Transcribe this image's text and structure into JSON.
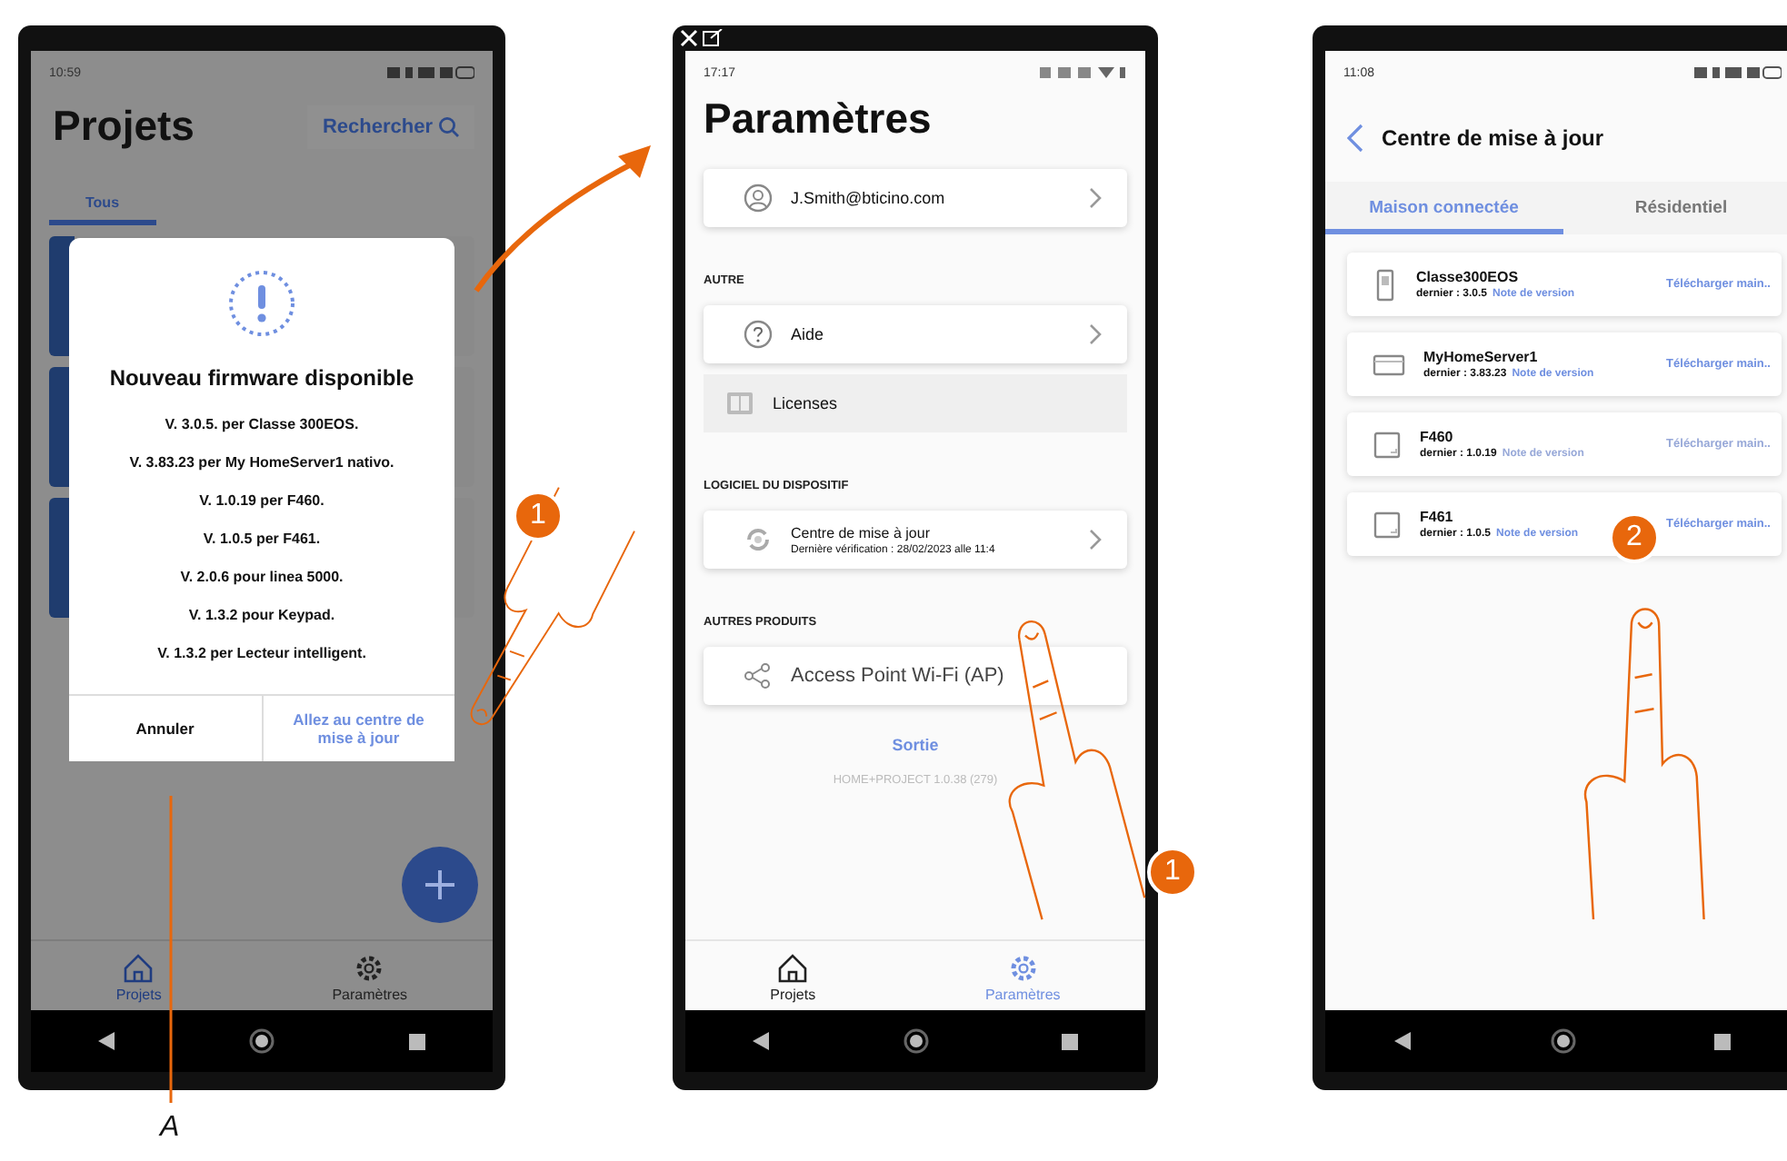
{
  "screen_projects": {
    "status_time": "10:59",
    "title": "Projets",
    "search_label": "Rechercher",
    "tabs": [
      {
        "label": "Tous",
        "selected": true
      }
    ],
    "dialog": {
      "title": "Nouveau firmware disponible",
      "lines": [
        "V. 3.0.5. per Classe 300EOS.",
        "V. 3.83.23 per My HomeServer1 nativo.",
        "V. 1.0.19 per F460.",
        "V. 1.0.5 per F461.",
        "V. 2.0.6 pour linea 5000.",
        "V. 1.3.2 pour Keypad.",
        "V. 1.3.2 per Lecteur intelligent."
      ],
      "buttons": [
        {
          "label": "Annuler",
          "kind": "cancel"
        },
        {
          "label": "Allez au centre de mise à jour",
          "kind": "confirm"
        }
      ]
    },
    "bottom_nav": [
      {
        "label": "Projets",
        "selected": true
      },
      {
        "label": "Paramètres",
        "selected": false
      }
    ]
  },
  "screen_settings": {
    "status_time": "17:17",
    "title": "Paramètres",
    "sections": [
      {
        "items": [
          {
            "kind": "card",
            "label": "J.Smith@bticino.com",
            "chevron": true
          }
        ]
      },
      {
        "heading": "AUTRE",
        "items": [
          {
            "kind": "card",
            "label": "Aide",
            "chevron": true
          },
          {
            "kind": "plain",
            "label": "Licenses",
            "chevron": false
          }
        ]
      },
      {
        "heading": "LOGICIEL DU DISPOSITIF",
        "items": [
          {
            "kind": "card",
            "label": "Centre de mise à jour",
            "subtitle": "Dernière vérification : 28/02/2023 alle 11:4",
            "chevron": true
          }
        ]
      },
      {
        "heading": "AUTRES PRODUITS",
        "items": [
          {
            "kind": "card",
            "label": "Access Point Wi-Fi (AP)",
            "chevron": false
          }
        ]
      }
    ],
    "logout": "Sortie",
    "version": "HOME+PROJECT 1.0.38 (279)",
    "bottom_nav": [
      {
        "label": "Projets",
        "selected": false
      },
      {
        "label": "Paramètres",
        "selected": true
      }
    ]
  },
  "screen_update_center": {
    "status_time": "11:08",
    "title": "Centre de mise à jour",
    "tabs": [
      {
        "label": "Maison connectée",
        "selected": true
      },
      {
        "label": "Résidentiel",
        "selected": false
      }
    ],
    "devices": [
      {
        "kind": "intercom",
        "name": "Classe300EOS",
        "latest": "dernier : 3.0.5",
        "notes_link": "Note de version",
        "action": "Télécharger main..",
        "disabled": false
      },
      {
        "kind": "server",
        "name": "MyHomeServer1",
        "latest": "dernier : 3.83.23",
        "notes_link": "Note de version",
        "action": "Télécharger main..",
        "disabled": false
      },
      {
        "kind": "panel",
        "name": "F460",
        "latest": "dernier : 1.0.19",
        "notes_link": "Note de version",
        "action": "Télécharger main..",
        "disabled": true
      },
      {
        "kind": "panel",
        "name": "F461",
        "latest": "dernier : 1.0.5",
        "notes_link": "Note de version",
        "action": "Télécharger main..",
        "disabled": false
      }
    ]
  },
  "step_badges": [
    {
      "label": "1"
    },
    {
      "label": "1"
    },
    {
      "label": "2"
    }
  ],
  "callout": {
    "label": "A"
  }
}
